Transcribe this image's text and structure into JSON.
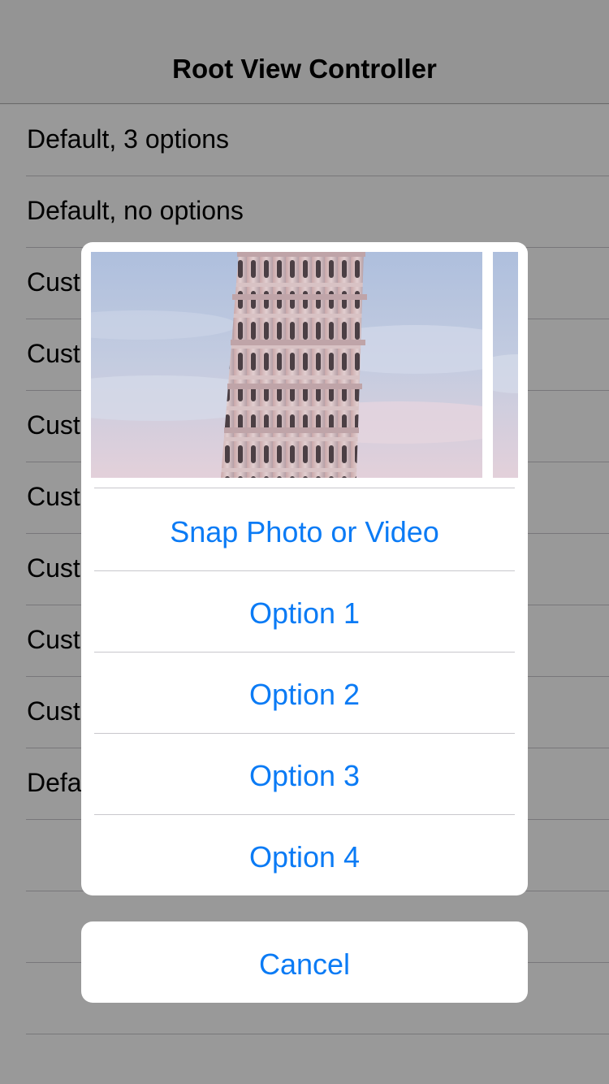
{
  "navbar": {
    "title": "Root View Controller"
  },
  "list": {
    "rows": [
      {
        "label": "Default, 3 options"
      },
      {
        "label": "Default, no options"
      },
      {
        "label": "Cust"
      },
      {
        "label": "Cust"
      },
      {
        "label": "Cust"
      },
      {
        "label": "Cust"
      },
      {
        "label": "Cust"
      },
      {
        "label": "Cust"
      },
      {
        "label": "Cust"
      },
      {
        "label": "Defa"
      },
      {
        "label": ""
      },
      {
        "label": ""
      },
      {
        "label": ""
      }
    ]
  },
  "action_sheet": {
    "gallery": {
      "photos": [
        "leaning-tower-photo",
        "leaning-tower-photo"
      ]
    },
    "actions": [
      {
        "label": "Snap Photo or Video"
      },
      {
        "label": "Option 1"
      },
      {
        "label": "Option 2"
      },
      {
        "label": "Option 3"
      },
      {
        "label": "Option 4"
      }
    ],
    "cancel_label": "Cancel"
  },
  "colors": {
    "accent": "#0b7bf5",
    "dim_overlay": "rgba(0,0,0,0.4)",
    "separator": "#c8c7cc"
  }
}
